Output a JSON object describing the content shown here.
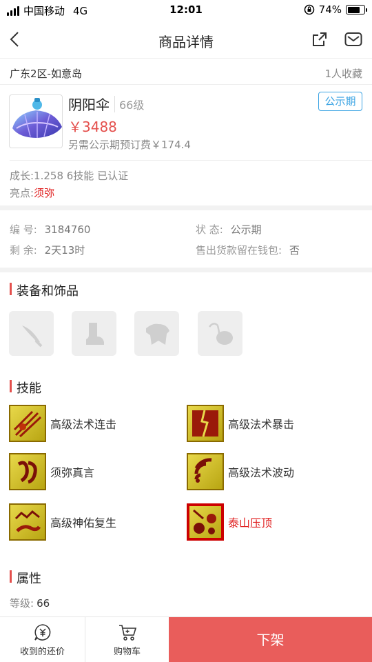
{
  "status_bar": {
    "carrier": "中国移动",
    "network": "4G",
    "time": "12:01",
    "battery": "74%",
    "battery_level": 0.74
  },
  "nav": {
    "title": "商品详情"
  },
  "region": {
    "server": "广东2区-如意岛",
    "favorites": "1人收藏"
  },
  "item": {
    "name": "阴阳伞",
    "level": "66级",
    "price": "￥3488",
    "fee": "另需公示期预订费￥174.4",
    "phase_badge": "公示期",
    "growth": "成长:1.258 6技能 已认证",
    "highlight_label": "亮点:",
    "highlight_value": "须弥"
  },
  "info": {
    "id_label": "编 号:",
    "id_value": "3184760",
    "status_label": "状 态:",
    "status_value": "公示期",
    "remain_label": "剩 余:",
    "remain_value": "2天13时",
    "wallet_label": "售出货款留在钱包:",
    "wallet_value": "否"
  },
  "sections": {
    "equipment": "装备和饰品",
    "skills": "技能",
    "attributes": "属性"
  },
  "equipment_slots": [
    "weapon-icon",
    "boots-icon",
    "armor-icon",
    "accessory-icon"
  ],
  "skills": [
    {
      "name": "高级法术连击",
      "icon": "spell-combo-icon",
      "highlight": false
    },
    {
      "name": "高级法术暴击",
      "icon": "spell-crit-icon",
      "highlight": false
    },
    {
      "name": "须弥真言",
      "icon": "sumeru-mantra-icon",
      "highlight": false
    },
    {
      "name": "高级法术波动",
      "icon": "spell-wave-icon",
      "highlight": false
    },
    {
      "name": "高级神佑复生",
      "icon": "divine-revival-icon",
      "highlight": false
    },
    {
      "name": "泰山压顶",
      "icon": "mount-tai-icon",
      "highlight": true
    }
  ],
  "attributes": {
    "level_label": "等级:",
    "level_value": "66"
  },
  "bottom_bar": {
    "offers_label": "收到的还价",
    "cart_label": "购物车",
    "action_label": "下架"
  },
  "colors": {
    "accent": "#e4504d",
    "action": "#e95d5b",
    "badge": "#3aa3e3",
    "highlight_text": "#e02020"
  }
}
